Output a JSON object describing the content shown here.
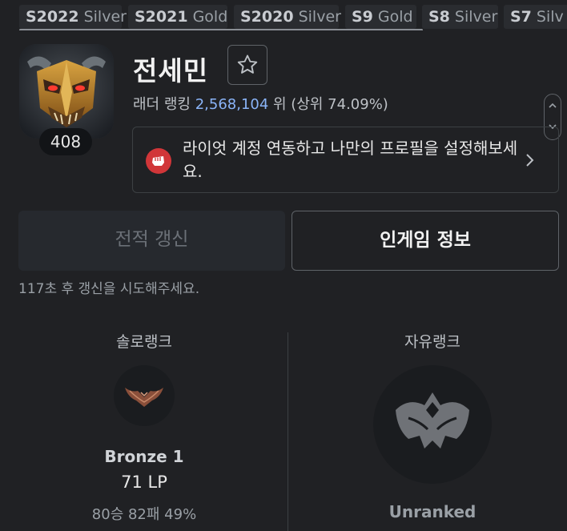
{
  "seasons": [
    {
      "season": "S2022",
      "tier": "Silver"
    },
    {
      "season": "S2021",
      "tier": "Gold"
    },
    {
      "season": "S2020",
      "tier": "Silver"
    },
    {
      "season": "S9",
      "tier": "Gold"
    },
    {
      "season": "S8",
      "tier": "Silver"
    },
    {
      "season": "S7",
      "tier": "Silv"
    }
  ],
  "profile": {
    "name": "전세민",
    "level": "408",
    "ladder_prefix": "래더 랭킹 ",
    "ladder_rank": "2,568,104",
    "ladder_suffix": " 위 (상위 74.09%)",
    "profile_icon": "armored-helmet-portrait",
    "favorite_icon": "star-outline-icon"
  },
  "riot_link": {
    "text": "라이엇 계정 연동하고 나만의 프로필을 설정해보세요.",
    "icon": "riot-fist-icon"
  },
  "actions": {
    "update_label": "전적 갱신",
    "ingame_label": "인게임 정보",
    "cooldown_text": "117초 후 갱신을 시도해주세요."
  },
  "solo_rank": {
    "title": "솔로랭크",
    "tier": "Bronze 1",
    "lp": "71 LP",
    "record": "80승 82패 49%",
    "emblem": "bronze-emblem"
  },
  "flex_rank": {
    "title": "자유랭크",
    "status": "Unranked",
    "emblem": "unranked-emblem"
  },
  "colors": {
    "background": "#202124",
    "accent_blue": "#8ab4f8",
    "riot_red": "#d13639"
  }
}
